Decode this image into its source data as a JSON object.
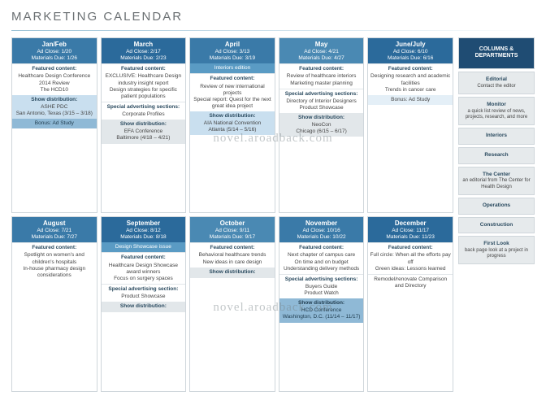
{
  "title": "MARKETING CALENDAR",
  "watermark": "novel.aroadback.com",
  "sidebar": {
    "header": "COLUMNS & DEPARTMENTS",
    "items": [
      {
        "name": "Editorial",
        "desc": "Contact the editor"
      },
      {
        "name": "Monitor",
        "desc": "a quick list review of news, projects, research, and more"
      },
      {
        "name": "Interiors",
        "desc": ""
      },
      {
        "name": "Research",
        "desc": ""
      },
      {
        "name": "The Center",
        "desc": "an editorial from The Center for Health Design"
      },
      {
        "name": "Operations",
        "desc": ""
      },
      {
        "name": "Construction",
        "desc": ""
      },
      {
        "name": "First Look",
        "desc": "back page look at a project in progress"
      }
    ]
  },
  "months": [
    {
      "name": "Jan/Feb",
      "shade": "shade2",
      "adclose": "Ad Close: 1/20",
      "matdue": "Materials Due: 1/26",
      "blocks": [
        {
          "style": "band-white",
          "title": "Featured content:",
          "body": "Healthcare Design Conference 2014 Review\nThe HCD10"
        },
        {
          "style": "band-lightblue",
          "title": "Show distribution:",
          "body": "ASHE PDC\nSan Antonio, Texas (3/15 – 3/18)"
        },
        {
          "style": "band-medblue",
          "title": "",
          "body": "Bonus: Ad Study"
        }
      ]
    },
    {
      "name": "March",
      "shade": "",
      "adclose": "Ad Close: 2/17",
      "matdue": "Materials Due: 2/23",
      "blocks": [
        {
          "style": "band-white",
          "title": "Featured content:",
          "body": "EXCLUSIVE: Healthcare Design industry insight report\nDesign strategies for specific patient populations"
        },
        {
          "style": "band-white",
          "title": "Special advertising sections:",
          "body": "Corporate Profiles"
        },
        {
          "style": "band-gray",
          "title": "Show distribution:",
          "body": "EFA Conference\nBaltimore (4/18 – 4/21)"
        }
      ]
    },
    {
      "name": "April",
      "shade": "shade2",
      "adclose": "Ad Close: 3/13",
      "matdue": "Materials Due: 3/19",
      "blocks": [
        {
          "style": "band-deepblue",
          "title": "",
          "body": "Interiors edition"
        },
        {
          "style": "band-white",
          "title": "Featured content:",
          "body": "Review of new international projects\nSpecial report: Quest for the next great idea project"
        },
        {
          "style": "band-lightblue",
          "title": "Show distribution:",
          "body": "AIA National Convention\nAtlanta (5/14 – 5/16)"
        }
      ]
    },
    {
      "name": "May",
      "shade": "shade3",
      "adclose": "Ad Close: 4/21",
      "matdue": "Materials Due: 4/27",
      "blocks": [
        {
          "style": "band-white",
          "title": "Featured content:",
          "body": "Review of healthcare interiors\nMarketing master planning"
        },
        {
          "style": "band-white",
          "title": "Special advertising sections:",
          "body": "Directory of Interior Designers\nProduct Showcase"
        },
        {
          "style": "band-gray",
          "title": "Show distribution:",
          "body": "NeoCon\nChicago (6/15 – 6/17)"
        }
      ]
    },
    {
      "name": "June/July",
      "shade": "",
      "adclose": "Ad Close: 6/10",
      "matdue": "Materials Due: 6/16",
      "blocks": [
        {
          "style": "band-white",
          "title": "Featured content:",
          "body": "Designing research and academic facilities\nTrends in cancer care"
        },
        {
          "style": "band-vltblue",
          "title": "",
          "body": "Bonus: Ad Study"
        }
      ]
    },
    {
      "name": "August",
      "shade": "shade2",
      "adclose": "Ad Close: 7/21",
      "matdue": "Materials Due: 7/27",
      "blocks": [
        {
          "style": "band-white",
          "title": "Featured content:",
          "body": "Spotlight on women's and children's hospitals\nIn-house pharmacy design considerations"
        }
      ]
    },
    {
      "name": "September",
      "shade": "",
      "adclose": "Ad Close: 8/12",
      "matdue": "Materials Due: 8/18",
      "blocks": [
        {
          "style": "band-deepblue",
          "title": "",
          "body": "Design Showcase issue"
        },
        {
          "style": "band-white",
          "title": "Featured content:",
          "body": "Healthcare Design Showcase award winners\nFocus on surgery spaces"
        },
        {
          "style": "band-white",
          "title": "Special advertising section:",
          "body": "Product Showcase"
        },
        {
          "style": "band-gray",
          "title": "Show distribution:",
          "body": ""
        }
      ]
    },
    {
      "name": "October",
      "shade": "shade3",
      "adclose": "Ad Close: 9/11",
      "matdue": "Materials Due: 9/17",
      "blocks": [
        {
          "style": "band-white",
          "title": "Featured content:",
          "body": "Behavioral healthcare trends\nNew ideas in care design"
        },
        {
          "style": "band-gray",
          "title": "Show distribution:",
          "body": ""
        }
      ]
    },
    {
      "name": "November",
      "shade": "shade2",
      "adclose": "Ad Close: 10/16",
      "matdue": "Materials Due: 10/22",
      "blocks": [
        {
          "style": "band-white",
          "title": "Featured content:",
          "body": "Next chapter of campus care\nOn time and on budget\nUnderstanding delivery methods"
        },
        {
          "style": "band-white",
          "title": "Special advertising sections:",
          "body": "Buyers Guide\nProduct Watch"
        },
        {
          "style": "band-medblue",
          "title": "Show distribution:",
          "body": "HCD Conference\nWashington, D.C. (11/14 – 11/17)"
        }
      ]
    },
    {
      "name": "December",
      "shade": "",
      "adclose": "Ad Close: 11/17",
      "matdue": "Materials Due: 11/23",
      "blocks": [
        {
          "style": "band-white",
          "title": "Featured content:",
          "body": "Full circle: When all the efforts pay off\nGreen ideas: Lessons learned"
        },
        {
          "style": "band-white",
          "title": "",
          "body": "Remodel/renovate Comparison and Directory"
        }
      ]
    }
  ]
}
